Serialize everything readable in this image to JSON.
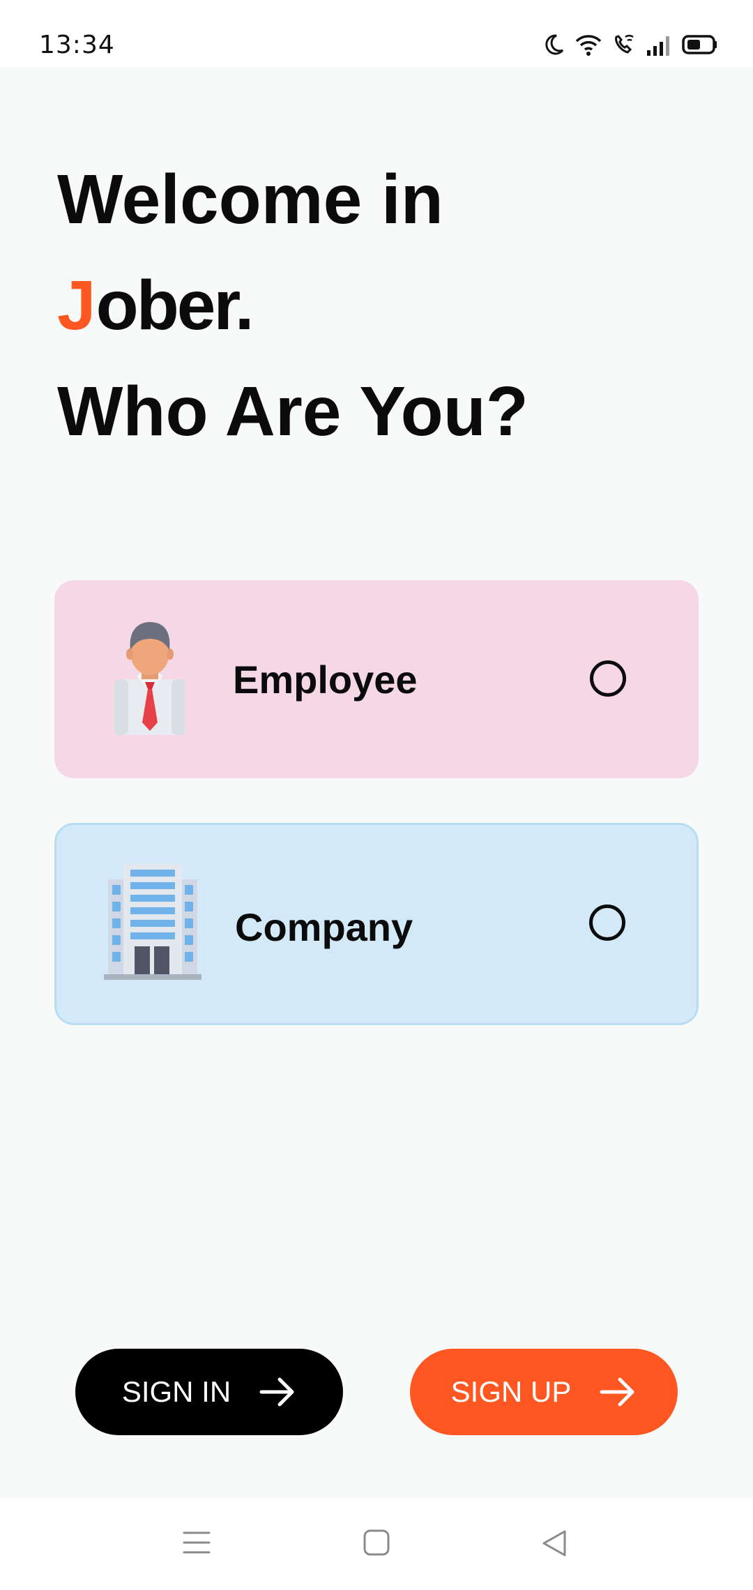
{
  "status_bar": {
    "time": "13:34",
    "icons": [
      "moon-icon",
      "wifi-icon",
      "wifi-call-icon",
      "signal-icon",
      "battery-icon"
    ]
  },
  "headline": {
    "line1": "Welcome in",
    "brand_first_letter": "J",
    "brand_rest": "ober.",
    "line3": "Who Are You?"
  },
  "roles": {
    "employee": {
      "label": "Employee",
      "icon": "employee-icon",
      "selected": false
    },
    "company": {
      "label": "Company",
      "icon": "building-icon",
      "selected": false
    }
  },
  "buttons": {
    "signin_label": "SIGN IN",
    "signup_label": "SIGN UP",
    "arrow_icon": "arrow-right-icon"
  },
  "colors": {
    "accent": "#ff5722",
    "employee_card": "#f6d7e6",
    "company_card": "#d3e9f8",
    "background": "#f8f9f9"
  },
  "nav_bar": {
    "icons": [
      "menu-icon",
      "home-square-icon",
      "back-triangle-icon"
    ]
  }
}
